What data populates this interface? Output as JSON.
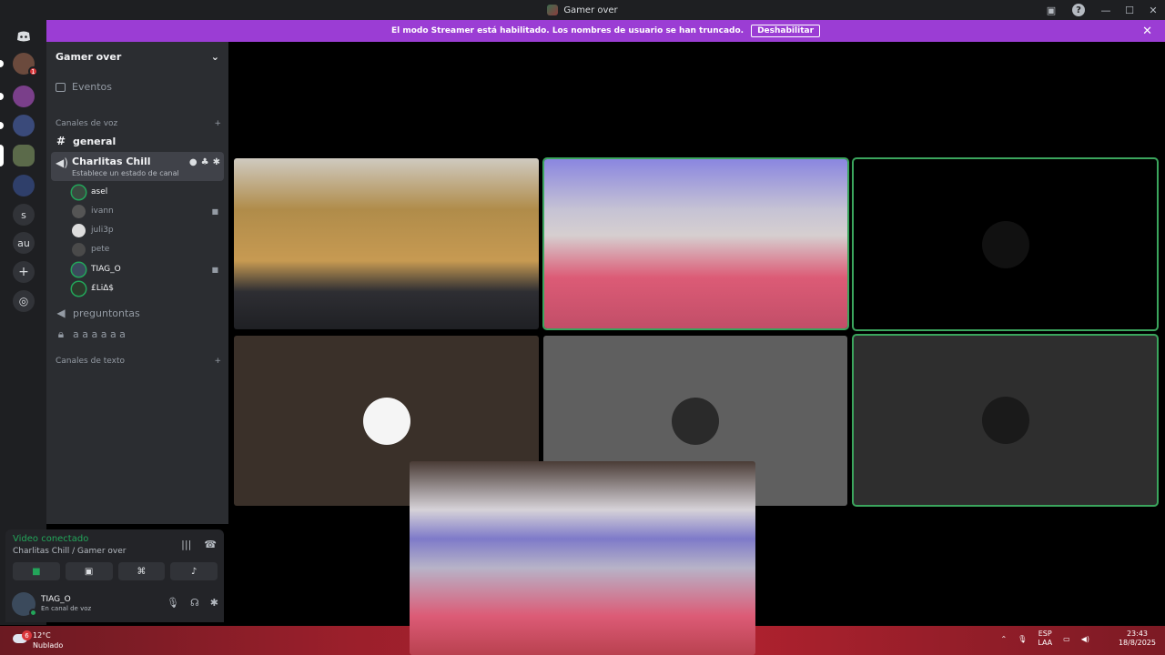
{
  "titlebar": {
    "title": "Gamer over",
    "help_label": "?",
    "minimize": "—",
    "maximize": "☐",
    "close": "✕"
  },
  "banner": {
    "text": "El modo Streamer está habilitado. Los nombres de usuario se han truncado.",
    "button": "Deshabilitar",
    "close": "✕"
  },
  "guilds": [
    {
      "label": "",
      "badge": "1"
    },
    {
      "label": "",
      "badge": ""
    },
    {
      "label": "",
      "badge": ""
    },
    {
      "label": "",
      "badge": ""
    },
    {
      "label": "",
      "badge": ""
    },
    {
      "label": "s",
      "badge": ""
    },
    {
      "label": "au",
      "badge": ""
    }
  ],
  "server": {
    "name": "Gamer over",
    "eventos": "Eventos",
    "voice_category": "Canales de voz",
    "text_category": "Canales de texto",
    "channels": {
      "general": "general",
      "active_name": "Charlitas Chill",
      "active_status": "Establece un estado de canal",
      "pregunta": "preguntontas",
      "locked": "a a a a a a"
    },
    "voice_users": [
      "asel",
      "ivann",
      "juli3p",
      "pete",
      "TIAG_O",
      "£Li∆$"
    ]
  },
  "voice_panel": {
    "title": "Video conectado",
    "subtitle": "Charlitas Chill / Gamer over"
  },
  "user": {
    "name": "TIAG_O",
    "status": "En canal de voz"
  },
  "taskbar": {
    "temp": "12°C",
    "weather": "Nublado",
    "weather_badge": "6",
    "lang1": "ESP",
    "lang2": "LAA",
    "time": "23:43",
    "date": "18/8/2025"
  },
  "colors": {
    "accent": "#9b3dd4",
    "speaking": "#3ba55d",
    "sidebar": "#2b2d31"
  }
}
